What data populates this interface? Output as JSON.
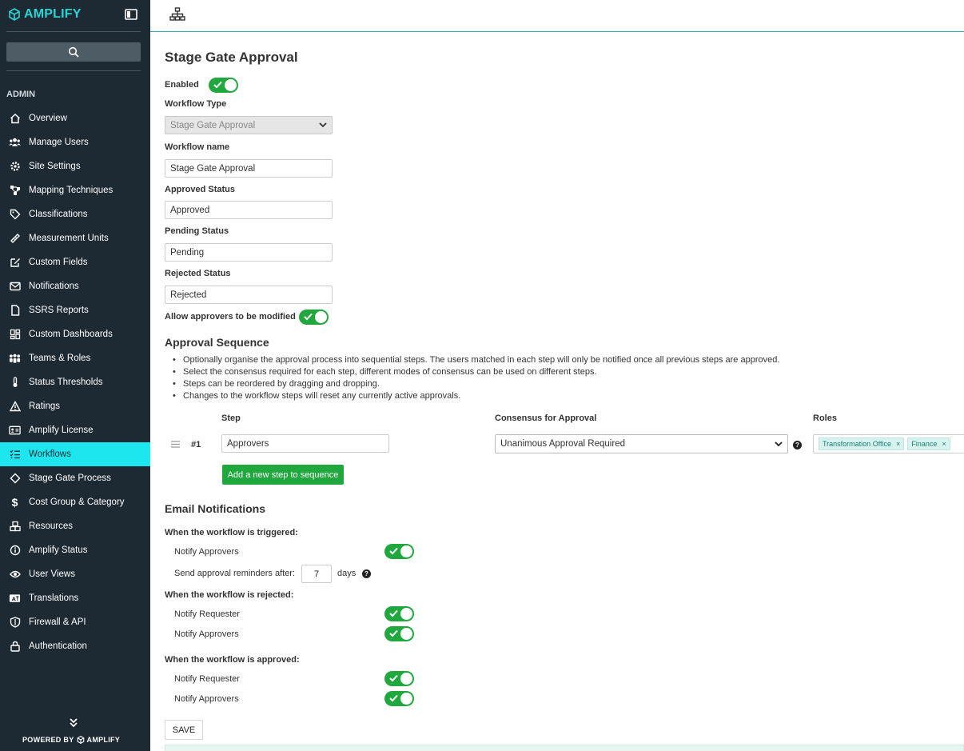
{
  "app": {
    "logo_text": "AMPLIFY",
    "powered_by": "POWERED BY",
    "powered_brand": "AMPLIFY",
    "accent_color": "#1ee6ef",
    "toggle_color": "#20a83f"
  },
  "sidebar": {
    "section": "ADMIN",
    "items": [
      {
        "label": "Overview",
        "icon": "home-icon"
      },
      {
        "label": "Manage Users",
        "icon": "users-icon"
      },
      {
        "label": "Site Settings",
        "icon": "gear-icon"
      },
      {
        "label": "Mapping Techniques",
        "icon": "network-icon"
      },
      {
        "label": "Classifications",
        "icon": "tag-icon"
      },
      {
        "label": "Measurement Units",
        "icon": "ruler-icon"
      },
      {
        "label": "Custom Fields",
        "icon": "edit-icon"
      },
      {
        "label": "Notifications",
        "icon": "envelope-icon"
      },
      {
        "label": "SSRS Reports",
        "icon": "file-icon"
      },
      {
        "label": "Custom Dashboards",
        "icon": "dashboard-icon"
      },
      {
        "label": "Teams & Roles",
        "icon": "team-icon"
      },
      {
        "label": "Status Thresholds",
        "icon": "thermometer-icon"
      },
      {
        "label": "Ratings",
        "icon": "warning-icon"
      },
      {
        "label": "Amplify License",
        "icon": "id-card-icon"
      },
      {
        "label": "Workflows",
        "icon": "list-check-icon"
      },
      {
        "label": "Stage Gate Process",
        "icon": "diamond-icon"
      },
      {
        "label": "Cost Group & Category",
        "icon": "dollar-icon"
      },
      {
        "label": "Resources",
        "icon": "boxes-icon"
      },
      {
        "label": "Amplify Status",
        "icon": "info-icon"
      },
      {
        "label": "User Views",
        "icon": "eye-icon"
      },
      {
        "label": "Translations",
        "icon": "language-icon"
      },
      {
        "label": "Firewall & API",
        "icon": "shield-icon"
      },
      {
        "label": "Authentication",
        "icon": "lock-icon"
      }
    ],
    "active_index": 14
  },
  "form": {
    "title": "Stage Gate Approval",
    "enabled_label": "Enabled",
    "enabled": true,
    "workflow_type_label": "Workflow Type",
    "workflow_type_value": "Stage Gate Approval",
    "workflow_name_label": "Workflow name",
    "workflow_name_value": "Stage Gate Approval",
    "approved_status_label": "Approved Status",
    "approved_status_value": "Approved",
    "pending_status_label": "Pending Status",
    "pending_status_value": "Pending",
    "rejected_status_label": "Rejected Status",
    "rejected_status_value": "Rejected",
    "allow_modify_label": "Allow approvers to be modified",
    "allow_modify": true
  },
  "sequence": {
    "title": "Approval Sequence",
    "bullets": [
      "Optionally organise the approval process into sequential steps. The users matched in each step will only be notified once all previous steps are approved.",
      "Select the consensus required for each step, different modes of consensus can be used on different steps.",
      "Steps can be reordered by dragging and dropping.",
      "Changes to the workflow steps will reset any currently active approvals."
    ],
    "col_step": "Step",
    "col_consensus": "Consensus for Approval",
    "col_roles": "Roles",
    "steps": [
      {
        "number": "#1",
        "name": "Approvers",
        "consensus": "Unanimous Approval Required",
        "roles": [
          "Transformation Office",
          "Finance"
        ]
      }
    ],
    "add_step_label": "Add a new step to sequence"
  },
  "email": {
    "title": "Email Notifications",
    "triggered_label": "When the workflow is triggered:",
    "triggered_notify_approvers": "Notify Approvers",
    "reminder_label": "Send approval reminders after:",
    "reminder_days": "7",
    "days_label": "days",
    "rejected_label": "When the workflow is rejected:",
    "rejected_notify_requester": "Notify Requester",
    "rejected_notify_approvers": "Notify Approvers",
    "approved_label": "When the workflow is approved:",
    "approved_notify_requester": "Notify Requester",
    "approved_notify_approvers": "Notify Approvers"
  },
  "actions": {
    "save_label": "SAVE",
    "remove_glyph": "×",
    "help_glyph": "?"
  }
}
